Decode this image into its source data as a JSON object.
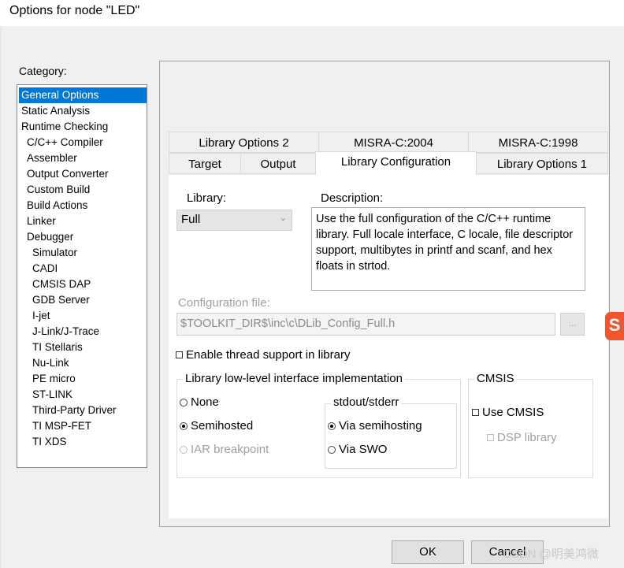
{
  "window": {
    "title": "Options for node \"LED\""
  },
  "category": {
    "label": "Category:",
    "items": [
      "General Options",
      "Static Analysis",
      "Runtime Checking",
      "C/C++ Compiler",
      "Assembler",
      "Output Converter",
      "Custom Build",
      "Build Actions",
      "Linker",
      "Debugger",
      "Simulator",
      "CADI",
      "CMSIS DAP",
      "GDB Server",
      "I-jet",
      "J-Link/J-Trace",
      "TI Stellaris",
      "Nu-Link",
      "PE micro",
      "ST-LINK",
      "Third-Party Driver",
      "TI MSP-FET",
      "TI XDS"
    ],
    "selected": "General Options"
  },
  "tabs": {
    "row1": [
      "Library Options 2",
      "MISRA-C:2004",
      "MISRA-C:1998"
    ],
    "row2": [
      "Target",
      "Output",
      "Library Configuration",
      "Library Options 1"
    ],
    "active": "Library Configuration"
  },
  "library": {
    "label": "Library:",
    "value": "Full",
    "description_label": "Description:",
    "description": "Use the full configuration of the C/C++ runtime library. Full locale interface, C locale, file descriptor support, multibytes in printf and scanf, and hex floats in strtod."
  },
  "config_file": {
    "label": "Configuration file:",
    "value": "$TOOLKIT_DIR$\\inc\\c\\DLib_Config_Full.h",
    "browse_label": "..."
  },
  "thread_support": {
    "label": "Enable thread support in library",
    "checked": false
  },
  "lowlevel": {
    "title": "Library low-level interface implementation",
    "options": [
      "None",
      "Semihosted",
      "IAR breakpoint"
    ],
    "selected": "Semihosted"
  },
  "stdout": {
    "title": "stdout/stderr",
    "options": [
      "Via semihosting",
      "Via SWO"
    ],
    "selected": "Via semihosting"
  },
  "cmsis": {
    "title": "CMSIS",
    "use_label": "Use CMSIS",
    "dsp_label": "DSP library"
  },
  "buttons": {
    "ok": "OK",
    "cancel": "Cancel"
  },
  "watermark": "CSDN @明美鸿微",
  "side_icon": "S"
}
